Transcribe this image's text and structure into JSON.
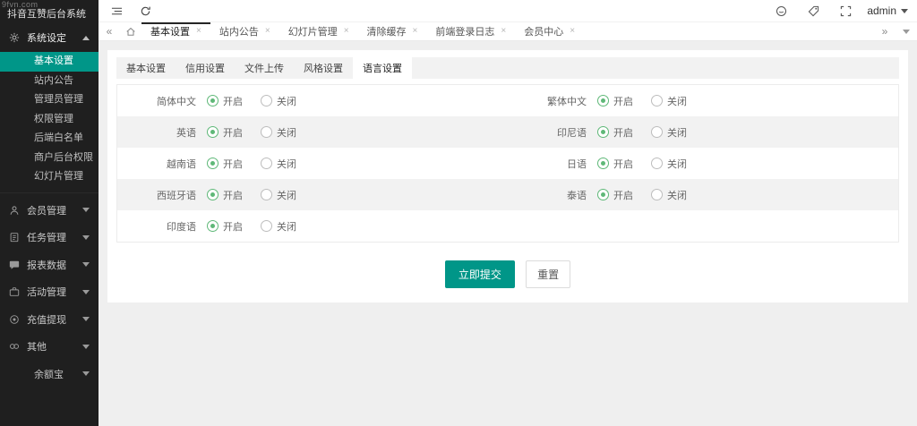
{
  "glyphs": {
    "close": "×",
    "chevrons_left": "«",
    "chevrons_right": "»"
  },
  "sidebar": {
    "watermark": "9fvn.com",
    "title": "抖音互赞后台系统",
    "system": {
      "label": "系统设定",
      "children": [
        "基本设置",
        "站内公告",
        "管理员管理",
        "权限管理",
        "后端白名单",
        "商户后台权限",
        "幻灯片管理"
      ],
      "active_child": "基本设置"
    },
    "items": [
      "会员管理",
      "任务管理",
      "报表数据",
      "活动管理",
      "充值提现",
      "其他"
    ],
    "sub_item": "余额宝"
  },
  "header": {
    "username": "admin"
  },
  "tabbar": {
    "tabs": [
      "基本设置",
      "站内公告",
      "幻灯片管理",
      "清除缓存",
      "前端登录日志",
      "会员中心"
    ],
    "active": "基本设置"
  },
  "content": {
    "tabs": [
      "基本设置",
      "信用设置",
      "文件上传",
      "风格设置",
      "语言设置"
    ],
    "active_tab": "语言设置",
    "form": {
      "radio_on": "开启",
      "radio_off": "关闭",
      "selected_value": "开启",
      "rows": [
        {
          "left": "简体中文",
          "right": "繁体中文"
        },
        {
          "left": "英语",
          "right": "印尼语"
        },
        {
          "left": "越南语",
          "right": "日语"
        },
        {
          "left": "西班牙语",
          "right": "泰语"
        },
        {
          "left": "印度语",
          "right": ""
        }
      ],
      "submit": "立即提交",
      "reset": "重置"
    }
  },
  "colors": {
    "accent": "#009688",
    "radio_checked": "#5FB878",
    "sidebar_bg": "#1f1f1f",
    "active_tab_bar": "#262626",
    "row_stripe": "#f2f2f2"
  },
  "icons": {
    "gear-icon": "⚙",
    "user-icon": "👤",
    "tasks-icon": "📋",
    "report-icon": "💬",
    "activity-icon": "💼",
    "recharge-icon": "◉",
    "link-icon": "🔗",
    "menu-fold-icon": "☰",
    "refresh-icon": "↻",
    "home-icon": "⌂",
    "message-icon": "◔",
    "tag-icon": "🏷",
    "fullscreen-icon": "⛶",
    "close-icon": "×",
    "chevron-down-icon": "▼",
    "chevron-up-icon": "▲"
  }
}
